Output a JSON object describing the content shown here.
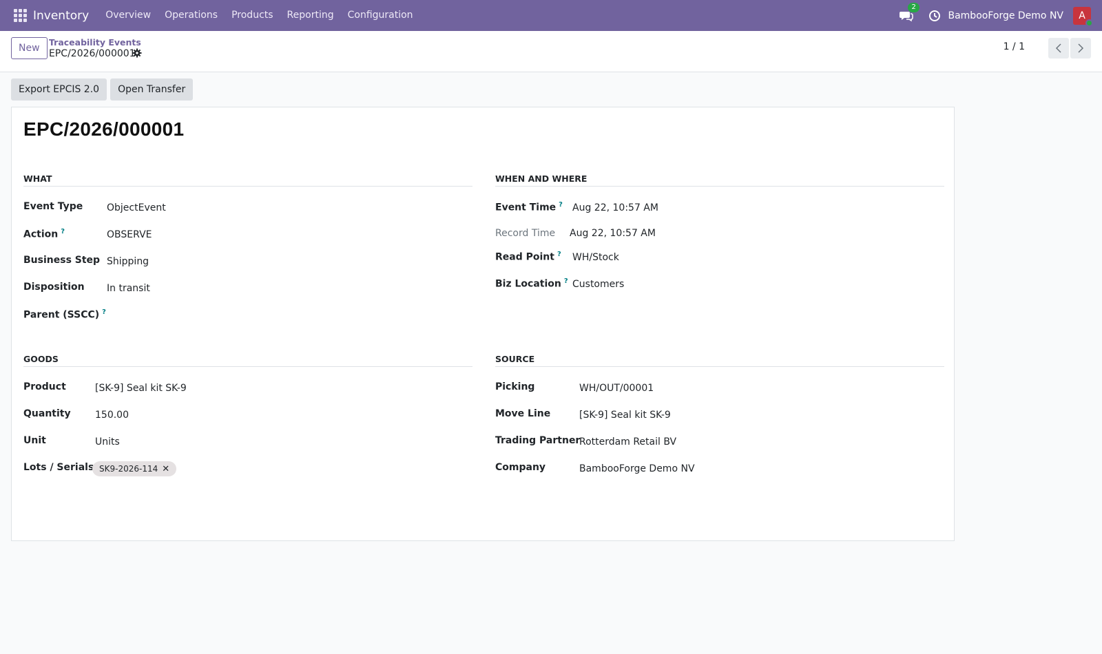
{
  "navbar": {
    "app_name": "Inventory",
    "menu": [
      "Overview",
      "Operations",
      "Products",
      "Reporting",
      "Configuration"
    ],
    "chat_count": "2",
    "company": "BambooForge Demo NV",
    "avatar_letter": "A"
  },
  "control": {
    "new_label": "New",
    "breadcrumb": "Traceability Events",
    "record_name": "EPC/2026/000001",
    "pager": "1 / 1"
  },
  "actions": {
    "export_label": "Export EPCIS 2.0",
    "open_transfer_label": "Open Transfer"
  },
  "form": {
    "title": "EPC/2026/000001",
    "what": {
      "title": "WHAT",
      "event_type_label": "Event Type",
      "event_type": "ObjectEvent",
      "action_label": "Action",
      "action": "OBSERVE",
      "business_step_label": "Business Step",
      "business_step": "Shipping",
      "disposition_label": "Disposition",
      "disposition": "In transit",
      "parent_label": "Parent (SSCC)"
    },
    "when": {
      "title": "WHEN AND WHERE",
      "event_time_label": "Event Time",
      "event_time": "Aug 22, 10:57 AM",
      "record_time_label": "Record Time",
      "record_time": "Aug 22, 10:57 AM",
      "read_point_label": "Read Point",
      "read_point": "WH/Stock",
      "biz_location_label": "Biz Location",
      "biz_location": "Customers"
    },
    "goods": {
      "title": "GOODS",
      "product_label": "Product",
      "product": "[SK-9] Seal kit SK-9",
      "quantity_label": "Quantity",
      "quantity": "150.00",
      "unit_label": "Unit",
      "unit": "Units",
      "lots_label": "Lots / Serials",
      "lot_tag": "SK9-2026-114"
    },
    "source": {
      "title": "SOURCE",
      "picking_label": "Picking",
      "picking": "WH/OUT/00001",
      "move_line_label": "Move Line",
      "move_line": "[SK-9] Seal kit SK-9",
      "partner_label": "Trading Partner",
      "partner": "Rotterdam Retail BV",
      "company_label": "Company",
      "company": "BambooForge Demo NV"
    },
    "help_mark": "?"
  }
}
